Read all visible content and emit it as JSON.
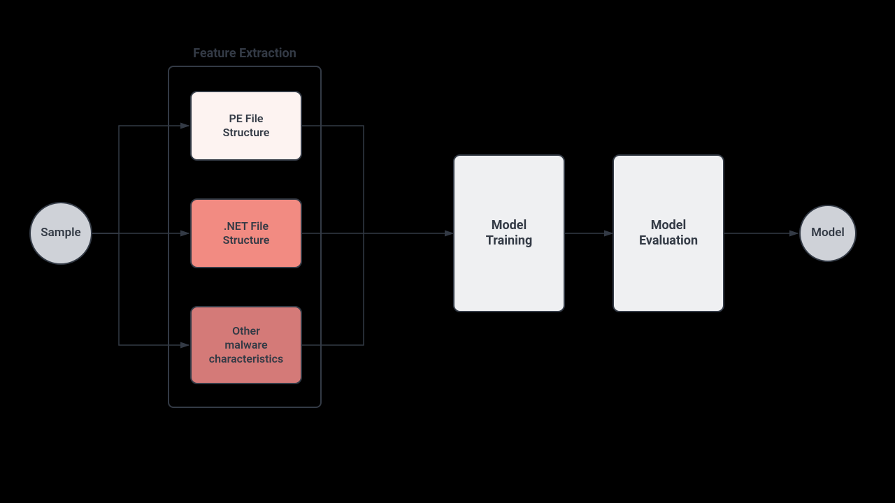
{
  "nodes": {
    "sample": "Sample",
    "model": "Model",
    "feature_extraction_title": "Feature Extraction",
    "pe_file": "PE File\nStructure",
    "net_file": ".NET File\nStructure",
    "other_malware": "Other\nmalware\ncharacteristics",
    "model_training": "Model\nTraining",
    "model_evaluation": "Model\nEvaluation"
  },
  "colors": {
    "bg": "#000000",
    "stroke": "#333a45",
    "circle_fill": "#cfd2d8",
    "big_box_fill": "#eff0f2",
    "pe_fill": "#fdf3f1",
    "net_fill": "#f28b82",
    "other_fill": "#d47a78"
  }
}
